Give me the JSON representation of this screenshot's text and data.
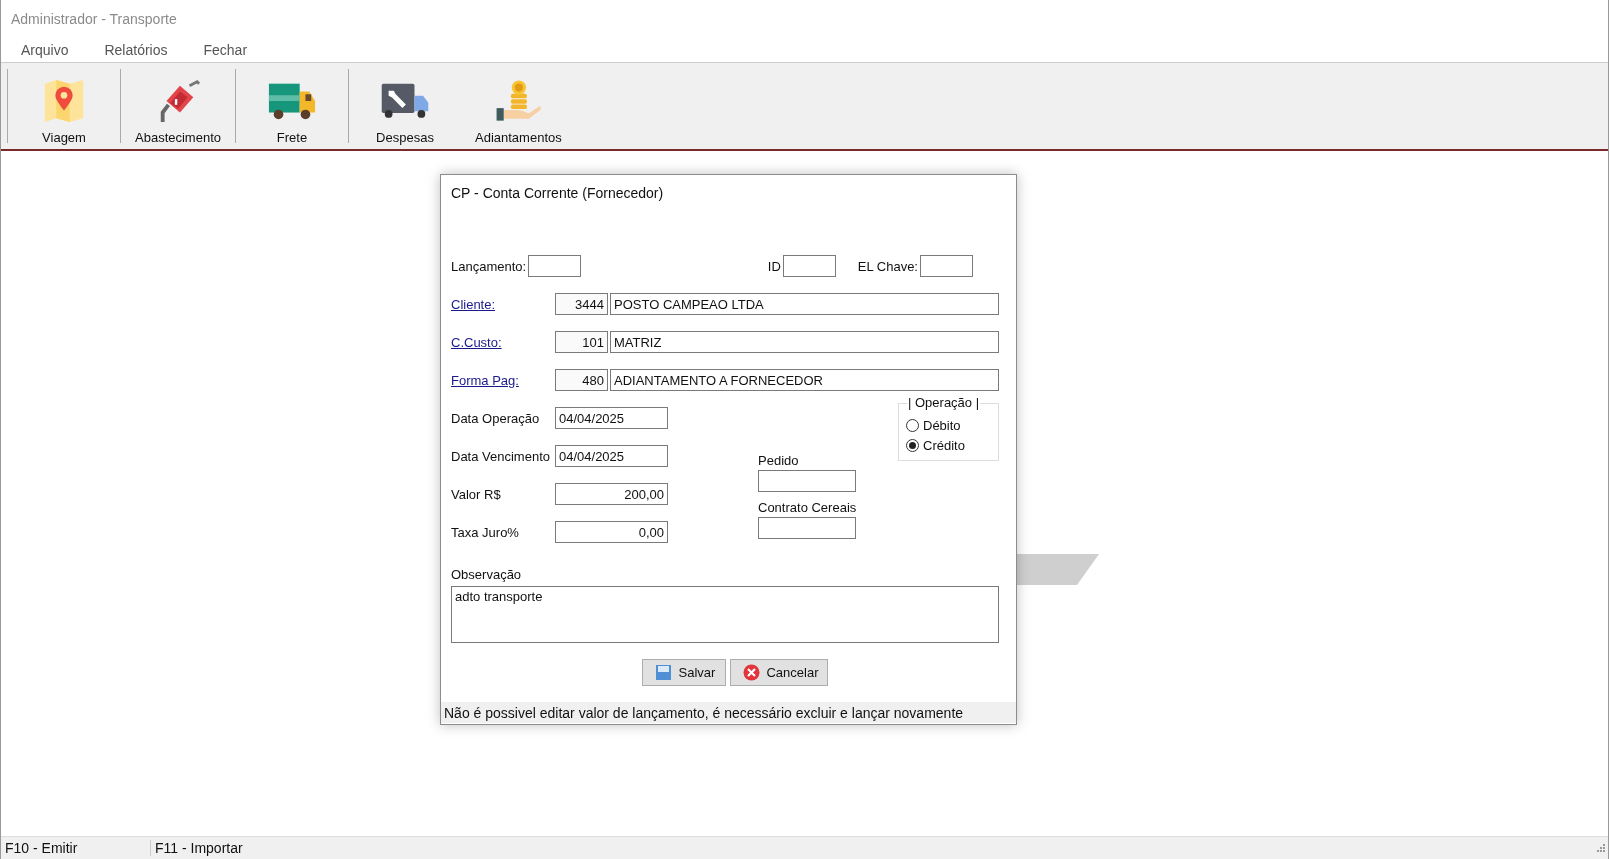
{
  "window": {
    "title": "Administrador - Transporte"
  },
  "menu": [
    {
      "label": "Arquivo"
    },
    {
      "label": "Relatórios"
    },
    {
      "label": "Fechar"
    }
  ],
  "toolbar": [
    {
      "label": "Viagem",
      "kind": "map"
    },
    {
      "label": "Abastecimento",
      "kind": "fuel"
    },
    {
      "label": "Frete",
      "kind": "truck"
    },
    {
      "label": "Despesas",
      "kind": "repair"
    },
    {
      "label": "Adiantamentos",
      "kind": "coins"
    }
  ],
  "dialog": {
    "title": "CP - Conta Corrente (Fornecedor)",
    "lancamento_label": "Lançamento:",
    "id_label": "ID",
    "el_chave_label": "EL Chave:",
    "lookups": [
      {
        "label": "Cliente:",
        "code": "3444",
        "name": "POSTO CAMPEAO LTDA"
      },
      {
        "label": "C.Custo:",
        "code": "101",
        "name": "MATRIZ"
      },
      {
        "label": "Forma Pag:",
        "code": "480",
        "name": "ADIANTAMENTO A FORNECEDOR"
      }
    ],
    "values": [
      {
        "label": "Data Operação",
        "value": "04/04/2025",
        "kind": "date"
      },
      {
        "label": "Data Vencimento",
        "value": "04/04/2025",
        "kind": "date"
      },
      {
        "label": "Valor R$",
        "value": "200,00",
        "kind": "amount"
      },
      {
        "label": "Taxa Juro%",
        "value": "0,00",
        "kind": "amount"
      }
    ],
    "pedido_label": "Pedido",
    "contrato_label": "Contrato Cereais",
    "operacao": {
      "title": "| Operação |",
      "options": [
        {
          "label": "Débito",
          "selected": false
        },
        {
          "label": "Crédito",
          "selected": true
        }
      ]
    },
    "observacao": {
      "label": "Observação",
      "value": "adto transporte"
    },
    "buttons": [
      {
        "label": "Salvar",
        "kind": "save"
      },
      {
        "label": "Cancelar",
        "kind": "cancel"
      }
    ],
    "status": "Não é possivel editar valor de lançamento, é necessário excluir e lançar novamente"
  },
  "status_bar": [
    "F10 - Emitir",
    "F11 - Importar"
  ]
}
